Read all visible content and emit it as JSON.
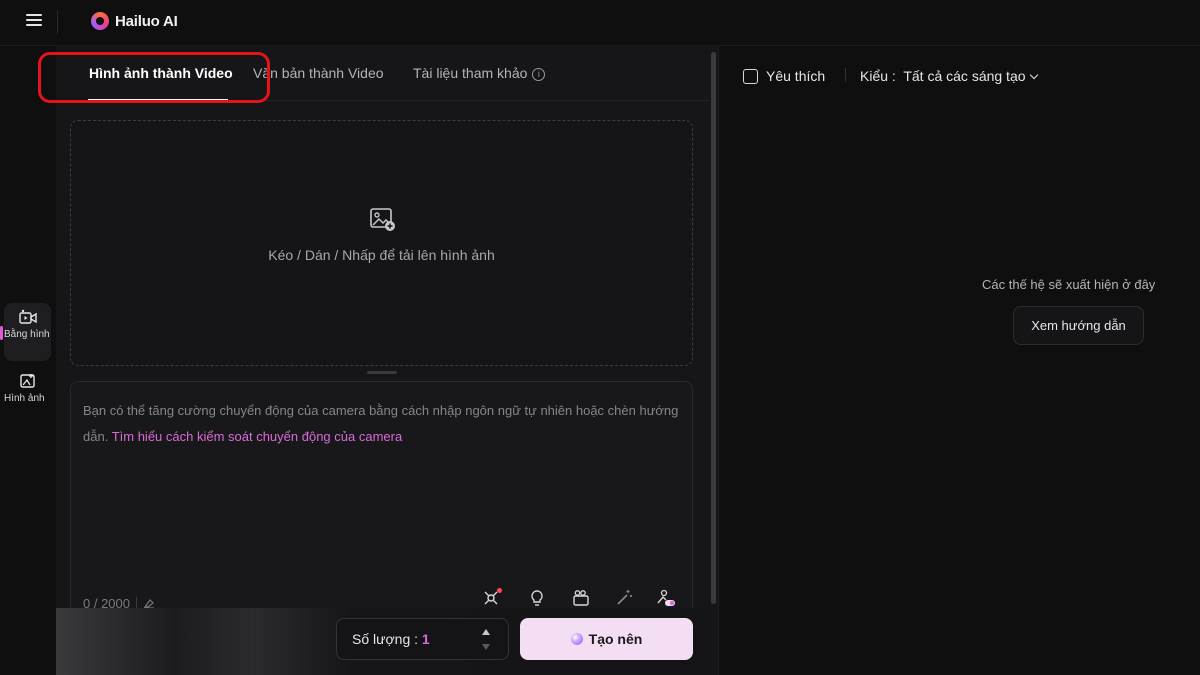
{
  "app": {
    "logo_text": "Hailuo AI"
  },
  "sidebar": {
    "items": [
      {
        "label": "Bằng hình",
        "icon": "video-camera-icon"
      },
      {
        "label": "Hình ảnh",
        "icon": "image-add-icon"
      }
    ]
  },
  "tabs": [
    {
      "label": "Hình ảnh thành Video"
    },
    {
      "label": "Văn bản thành Video"
    },
    {
      "label": "Tài liệu tham khảo"
    }
  ],
  "upload": {
    "text": "Kéo / Dán / Nhấp để tải lên hình ảnh"
  },
  "prompt": {
    "placeholder": "Bạn có thể tăng cường chuyển động của camera bằng cách nhập ngôn ngữ tự nhiên hoặc chèn hướng dẫn.",
    "link": "Tìm hiểu cách kiểm soát chuyển động của camera",
    "counter": "0 / 2000"
  },
  "controls": {
    "quantity_label": "Số lượng :",
    "quantity_value": "1",
    "create_label": "Tạo nên"
  },
  "right": {
    "favorite_label": "Yêu thích",
    "type_label": "Kiểu :",
    "type_value": "Tất cả các sáng tạo",
    "empty_text": "Các thế hệ sẽ xuất hiện ở đây",
    "guide_button": "Xem hướng dẫn"
  },
  "colors": {
    "accent": "#d96bd8",
    "create_button": "#f4def4",
    "highlight_box": "#e5141a"
  }
}
